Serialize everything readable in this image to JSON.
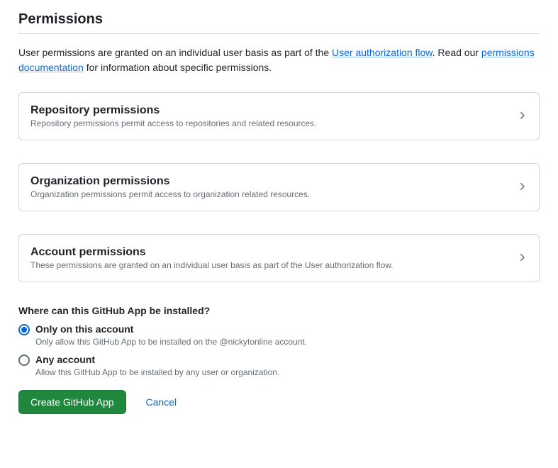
{
  "section": {
    "title": "Permissions",
    "intro_prefix": "User permissions are granted on an individual user basis as part of the ",
    "intro_link1": "User authorization flow",
    "intro_mid": ". Read our ",
    "intro_link2": "permissions documentation",
    "intro_suffix": " for information about specific permissions."
  },
  "cards": [
    {
      "title": "Repository permissions",
      "desc": "Repository permissions permit access to repositories and related resources."
    },
    {
      "title": "Organization permissions",
      "desc": "Organization permissions permit access to organization related resources."
    },
    {
      "title": "Account permissions",
      "desc": "These permissions are granted on an individual user basis as part of the User authorization flow."
    }
  ],
  "install": {
    "heading": "Where can this GitHub App be installed?",
    "options": [
      {
        "label": "Only on this account",
        "desc": "Only allow this GitHub App to be installed on the @nickytonline account.",
        "checked": true
      },
      {
        "label": "Any account",
        "desc": "Allow this GitHub App to be installed by any user or organization.",
        "checked": false
      }
    ]
  },
  "actions": {
    "create": "Create GitHub App",
    "cancel": "Cancel"
  }
}
